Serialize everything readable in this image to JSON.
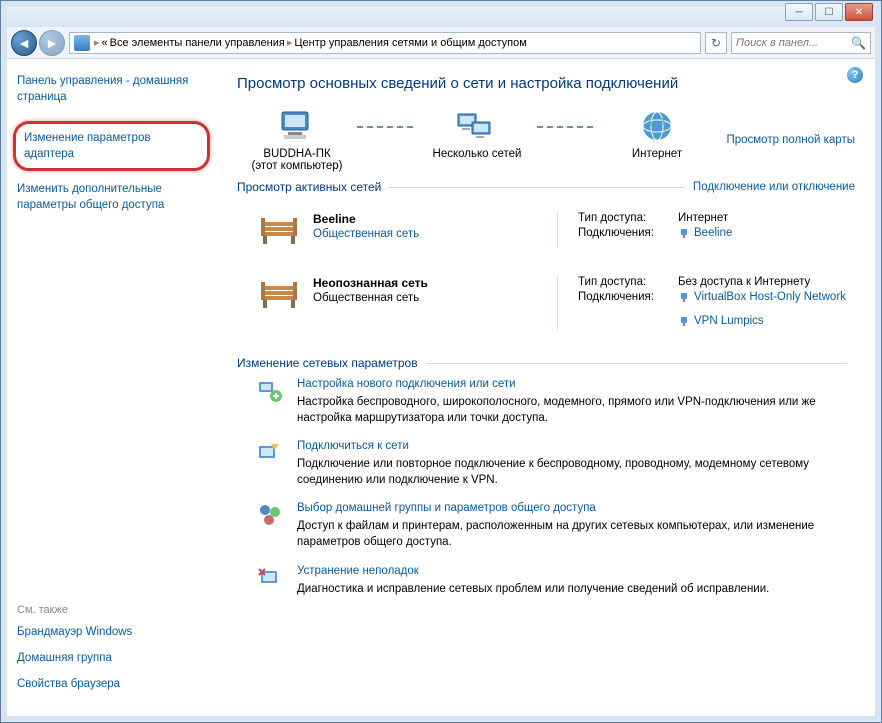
{
  "breadcrumb": {
    "part1_prefix": "«",
    "part1": "Все элементы панели управления",
    "part2": "Центр управления сетями и общим доступом"
  },
  "search": {
    "placeholder": "Поиск в панел..."
  },
  "sidebar": {
    "home": "Панель управления - домашняя страница",
    "links": [
      "Изменение параметров адаптера",
      "Изменить дополнительные параметры общего доступа"
    ],
    "see_also_title": "См. также",
    "see_also": [
      "Брандмауэр Windows",
      "Домашняя группа",
      "Свойства браузера"
    ]
  },
  "main": {
    "title": "Просмотр основных сведений о сети и настройка подключений",
    "map_link": "Просмотр полной карты",
    "nodes": {
      "pc_name": "BUDDHA-ПК",
      "pc_sub": "(этот компьютер)",
      "multi": "Несколько сетей",
      "internet": "Интернет"
    },
    "active_header": "Просмотр активных сетей",
    "active_link": "Подключение или отключение",
    "networks": [
      {
        "name": "Beeline",
        "type": "Общественная сеть",
        "type_link": true,
        "access_label": "Тип доступа:",
        "access_value": "Интернет",
        "conn_label": "Подключения:",
        "connections": [
          "Beeline"
        ]
      },
      {
        "name": "Неопознанная сеть",
        "type": "Общественная сеть",
        "type_link": false,
        "access_label": "Тип доступа:",
        "access_value": "Без доступа к Интернету",
        "conn_label": "Подключения:",
        "connections": [
          "VirtualBox Host-Only Network",
          "VPN Lumpics"
        ]
      }
    ],
    "change_header": "Изменение сетевых параметров",
    "tasks": [
      {
        "link": "Настройка нового подключения или сети",
        "desc": "Настройка беспроводного, широкополосного, модемного, прямого или VPN-подключения или же настройка маршрутизатора или точки доступа."
      },
      {
        "link": "Подключиться к сети",
        "desc": "Подключение или повторное подключение к беспроводному, проводному, модемному сетевому соединению или подключение к VPN."
      },
      {
        "link": "Выбор домашней группы и параметров общего доступа",
        "desc": "Доступ к файлам и принтерам, расположенным на других сетевых компьютерах, или изменение параметров общего доступа."
      },
      {
        "link": "Устранение неполадок",
        "desc": "Диагностика и исправление сетевых проблем или получение сведений об исправлении."
      }
    ]
  }
}
